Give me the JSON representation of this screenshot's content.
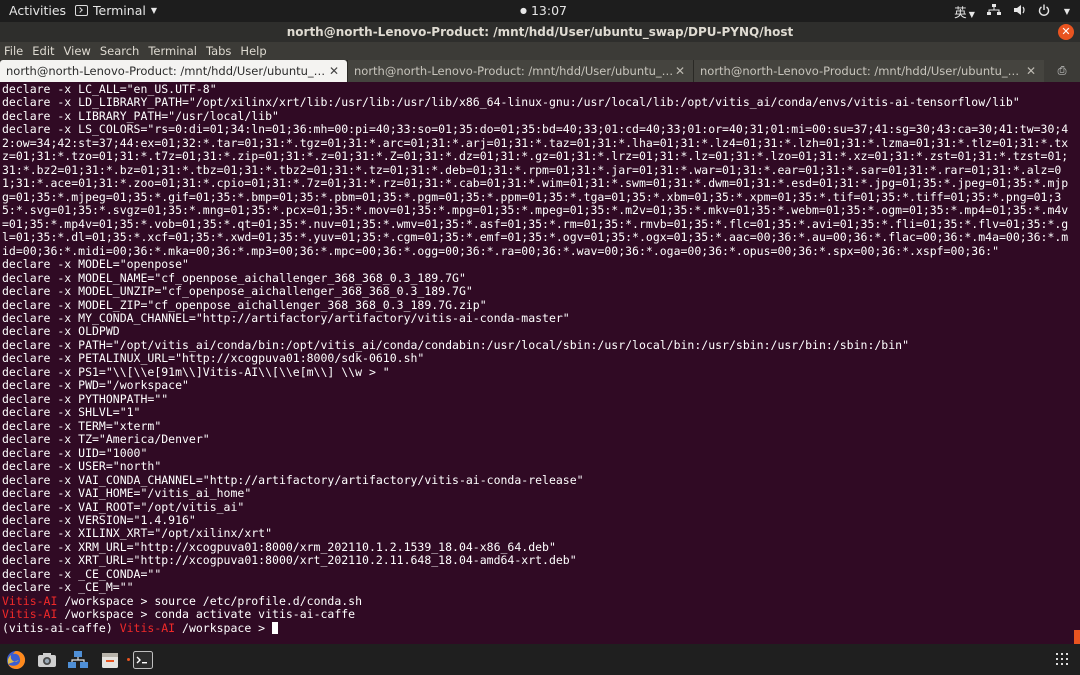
{
  "topbar": {
    "activities": "Activities",
    "app_name": "Terminal",
    "clock": "13:07",
    "input_method": "英"
  },
  "window": {
    "title": "north@north-Lenovo-Product: /mnt/hdd/User/ubuntu_swap/DPU-PYNQ/host"
  },
  "menubar": {
    "file": "File",
    "edit": "Edit",
    "view": "View",
    "search": "Search",
    "terminal": "Terminal",
    "tabs": "Tabs",
    "help": "Help"
  },
  "tabs": [
    {
      "label": "north@north-Lenovo-Product: /mnt/hdd/User/ubuntu_swap/DPU-PYNQ/host",
      "active": true
    },
    {
      "label": "north@north-Lenovo-Product: /mnt/hdd/User/ubuntu_swap/DPU-PYNQ/host",
      "active": false
    },
    {
      "label": "north@north-Lenovo-Product: /mnt/hdd/User/ubuntu_swap/DPU-PYNQ/host",
      "active": false
    }
  ],
  "terminal": {
    "lines": [
      "declare -x LC_ALL=\"en_US.UTF-8\"",
      "declare -x LD_LIBRARY_PATH=\"/opt/xilinx/xrt/lib:/usr/lib:/usr/lib/x86_64-linux-gnu:/usr/local/lib:/opt/vitis_ai/conda/envs/vitis-ai-tensorflow/lib\"",
      "declare -x LIBRARY_PATH=\"/usr/local/lib\"",
      "declare -x LS_COLORS=\"rs=0:di=01;34:ln=01;36:mh=00:pi=40;33:so=01;35:do=01;35:bd=40;33;01:cd=40;33;01:or=40;31;01:mi=00:su=37;41:sg=30;43:ca=30;41:tw=30;42:ow=34;42:st=37;44:ex=01;32:*.tar=01;31:*.tgz=01;31:*.arc=01;31:*.arj=01;31:*.taz=01;31:*.lha=01;31:*.lz4=01;31:*.lzh=01;31:*.lzma=01;31:*.tlz=01;31:*.txz=01;31:*.tzo=01;31:*.t7z=01;31:*.zip=01;31:*.z=01;31:*.Z=01;31:*.dz=01;31:*.gz=01;31:*.lrz=01;31:*.lz=01;31:*.lzo=01;31:*.xz=01;31:*.zst=01;31:*.tzst=01;31:*.bz2=01;31:*.bz=01;31:*.tbz=01;31:*.tbz2=01;31:*.tz=01;31:*.deb=01;31:*.rpm=01;31:*.jar=01;31:*.war=01;31:*.ear=01;31:*.sar=01;31:*.rar=01;31:*.alz=01;31:*.ace=01;31:*.zoo=01;31:*.cpio=01;31:*.7z=01;31:*.rz=01;31:*.cab=01;31:*.wim=01;31:*.swm=01;31:*.dwm=01;31:*.esd=01;31:*.jpg=01;35:*.jpeg=01;35:*.mjpg=01;35:*.mjpeg=01;35:*.gif=01;35:*.bmp=01;35:*.pbm=01;35:*.pgm=01;35:*.ppm=01;35:*.tga=01;35:*.xbm=01;35:*.xpm=01;35:*.tif=01;35:*.tiff=01;35:*.png=01;35:*.svg=01;35:*.svgz=01;35:*.mng=01;35:*.pcx=01;35:*.mov=01;35:*.mpg=01;35:*.mpeg=01;35:*.m2v=01;35:*.mkv=01;35:*.webm=01;35:*.ogm=01;35:*.mp4=01;35:*.m4v=01;35:*.mp4v=01;35:*.vob=01;35:*.qt=01;35:*.nuv=01;35:*.wmv=01;35:*.asf=01;35:*.rm=01;35:*.rmvb=01;35:*.flc=01;35:*.avi=01;35:*.fli=01;35:*.flv=01;35:*.gl=01;35:*.dl=01;35:*.xcf=01;35:*.xwd=01;35:*.yuv=01;35:*.cgm=01;35:*.emf=01;35:*.ogv=01;35:*.ogx=01;35:*.aac=00;36:*.au=00;36:*.flac=00;36:*.m4a=00;36:*.mid=00;36:*.midi=00;36:*.mka=00;36:*.mp3=00;36:*.mpc=00;36:*.ogg=00;36:*.ra=00;36:*.wav=00;36:*.oga=00;36:*.opus=00;36:*.spx=00;36:*.xspf=00;36:\"",
      "declare -x MODEL=\"openpose\"",
      "declare -x MODEL_NAME=\"cf_openpose_aichallenger_368_368_0.3_189.7G\"",
      "declare -x MODEL_UNZIP=\"cf_openpose_aichallenger_368_368_0.3_189.7G\"",
      "declare -x MODEL_ZIP=\"cf_openpose_aichallenger_368_368_0.3_189.7G.zip\"",
      "declare -x MY_CONDA_CHANNEL=\"http://artifactory/artifactory/vitis-ai-conda-master\"",
      "declare -x OLDPWD",
      "declare -x PATH=\"/opt/vitis_ai/conda/bin:/opt/vitis_ai/conda/condabin:/usr/local/sbin:/usr/local/bin:/usr/sbin:/usr/bin:/sbin:/bin\"",
      "declare -x PETALINUX_URL=\"http://xcogpuva01:8000/sdk-0610.sh\"",
      "declare -x PS1=\"\\\\[\\\\e[91m\\\\]Vitis-AI\\\\[\\\\e[m\\\\] \\\\w > \"",
      "declare -x PWD=\"/workspace\"",
      "declare -x PYTHONPATH=\"\"",
      "declare -x SHLVL=\"1\"",
      "declare -x TERM=\"xterm\"",
      "declare -x TZ=\"America/Denver\"",
      "declare -x UID=\"1000\"",
      "declare -x USER=\"north\"",
      "declare -x VAI_CONDA_CHANNEL=\"http://artifactory/artifactory/vitis-ai-conda-release\"",
      "declare -x VAI_HOME=\"/vitis_ai_home\"",
      "declare -x VAI_ROOT=\"/opt/vitis_ai\"",
      "declare -x VERSION=\"1.4.916\"",
      "declare -x XILINX_XRT=\"/opt/xilinx/xrt\"",
      "declare -x XRM_URL=\"http://xcogpuva01:8000/xrm_202110.1.2.1539_18.04-x86_64.deb\"",
      "declare -x XRT_URL=\"http://xcogpuva01:8000/xrt_202110.2.11.648_18.04-amd64-xrt.deb\"",
      "declare -x _CE_CONDA=\"\"",
      "declare -x _CE_M=\"\""
    ],
    "prompt1": {
      "host": "Vitis-AI",
      "cmd": " /workspace > source /etc/profile.d/conda.sh"
    },
    "prompt2": {
      "host": "Vitis-AI",
      "cmd": " /workspace > conda activate vitis-ai-caffe"
    },
    "prompt3": {
      "env": "(vitis-ai-caffe) ",
      "host": "Vitis-AI",
      "cmd": " /workspace > "
    }
  },
  "dock": {
    "items": [
      "firefox-icon",
      "screenshot-icon",
      "network-icon",
      "files-icon",
      "terminal-icon"
    ]
  },
  "colors": {
    "terminal_bg": "#300a24",
    "prompt_red": "#ef2929",
    "accent": "#e95420"
  }
}
